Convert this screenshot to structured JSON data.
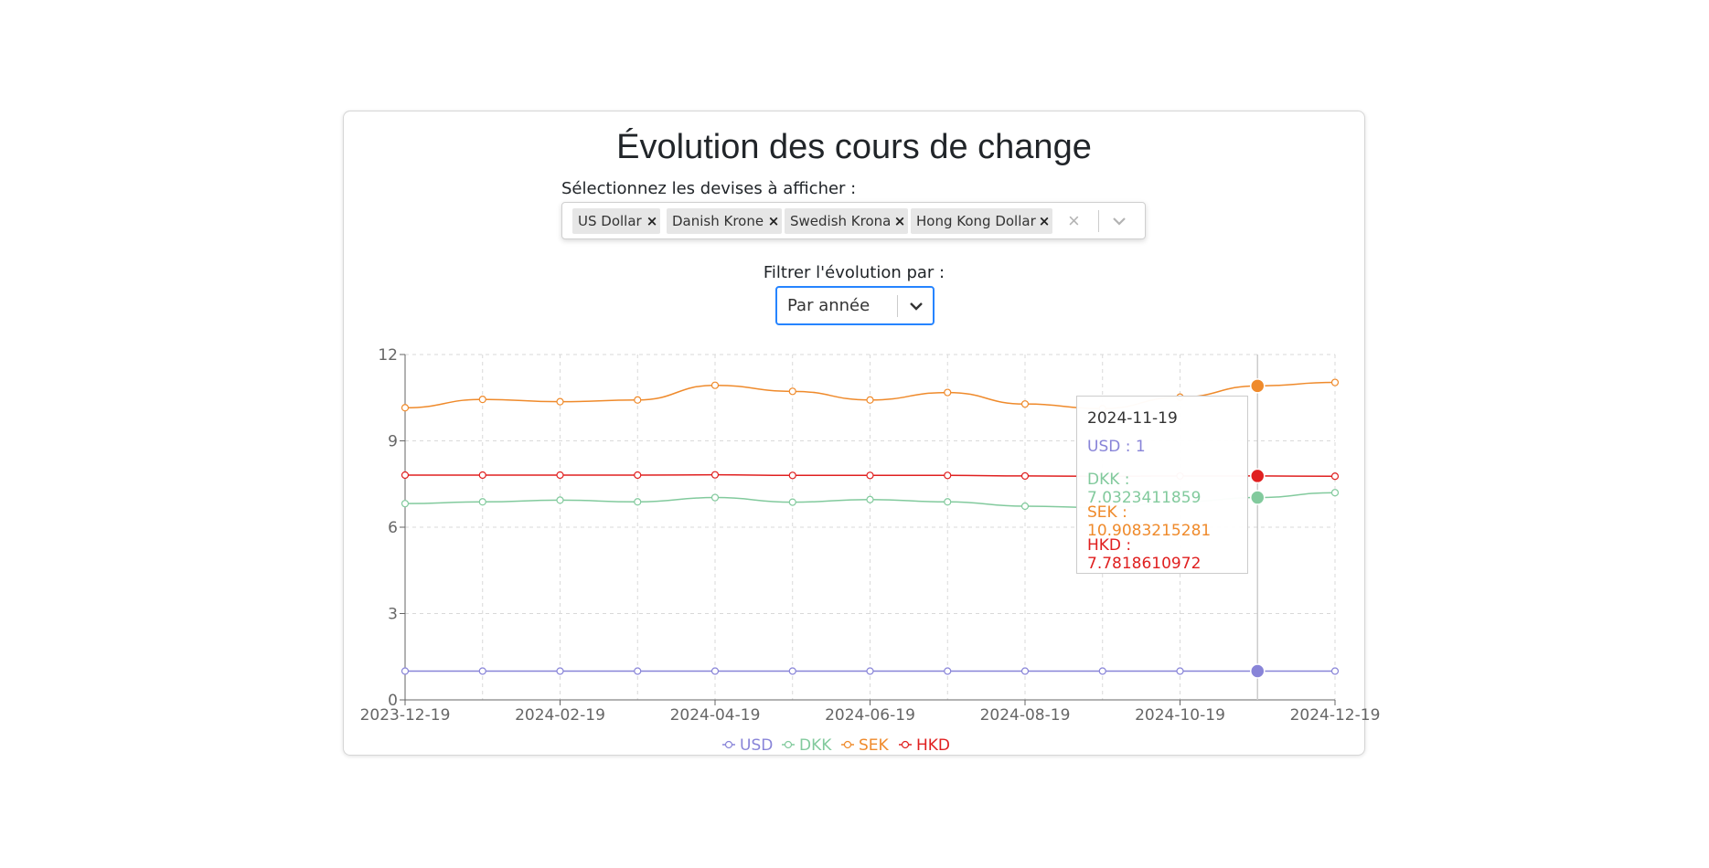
{
  "page": {
    "title": "Évolution des cours de change"
  },
  "currency_select": {
    "label": "Sélectionnez les devises à afficher :",
    "selected": [
      {
        "label": "US Dollar"
      },
      {
        "label": "Danish Krone"
      },
      {
        "label": "Swedish Krona"
      },
      {
        "label": "Hong Kong Dollar"
      }
    ],
    "remove_glyph": "×",
    "clear_glyph": "×"
  },
  "filter_select": {
    "label": "Filtrer l'évolution par :",
    "value": "Par année"
  },
  "chart_data": {
    "type": "line",
    "x": [
      "2023-12-19",
      "2024-01-19",
      "2024-02-19",
      "2024-03-19",
      "2024-04-19",
      "2024-05-19",
      "2024-06-19",
      "2024-07-19",
      "2024-08-19",
      "2024-09-19",
      "2024-10-19",
      "2024-11-19",
      "2024-12-19"
    ],
    "x_tick_labels": [
      "2023-12-19",
      "2024-02-19",
      "2024-04-19",
      "2024-06-19",
      "2024-08-19",
      "2024-10-19",
      "2024-12-19"
    ],
    "y_ticks": [
      0,
      3,
      6,
      9,
      12
    ],
    "ylim": [
      0,
      12
    ],
    "grid": true,
    "legend_position": "bottom",
    "series": [
      {
        "name": "USD",
        "color": "#8884d8",
        "values": [
          1,
          1,
          1,
          1,
          1,
          1,
          1,
          1,
          1,
          1,
          1,
          1,
          1
        ]
      },
      {
        "name": "DKK",
        "color": "#82ca9d",
        "values": [
          6.82,
          6.88,
          6.94,
          6.88,
          7.03,
          6.87,
          6.96,
          6.88,
          6.73,
          6.68,
          6.88,
          7.03,
          7.2
        ]
      },
      {
        "name": "SEK",
        "color": "#ef8a2b",
        "values": [
          10.15,
          10.44,
          10.36,
          10.42,
          10.93,
          10.72,
          10.42,
          10.68,
          10.28,
          10.12,
          10.52,
          10.91,
          11.03
        ]
      },
      {
        "name": "HKD",
        "color": "#e02020",
        "values": [
          7.81,
          7.81,
          7.81,
          7.81,
          7.82,
          7.8,
          7.8,
          7.8,
          7.78,
          7.77,
          7.78,
          7.78,
          7.77
        ]
      }
    ],
    "active_index": 11,
    "tooltip": {
      "date": "2024-11-19",
      "rows": [
        {
          "text": "USD : 1",
          "color": "#8884d8"
        },
        {
          "text": "DKK : 7.0323411859",
          "color": "#82ca9d"
        },
        {
          "text": "SEK : 10.9083215281",
          "color": "#ef8a2b"
        },
        {
          "text": "HKD : 7.7818610972",
          "color": "#e02020"
        }
      ]
    }
  }
}
